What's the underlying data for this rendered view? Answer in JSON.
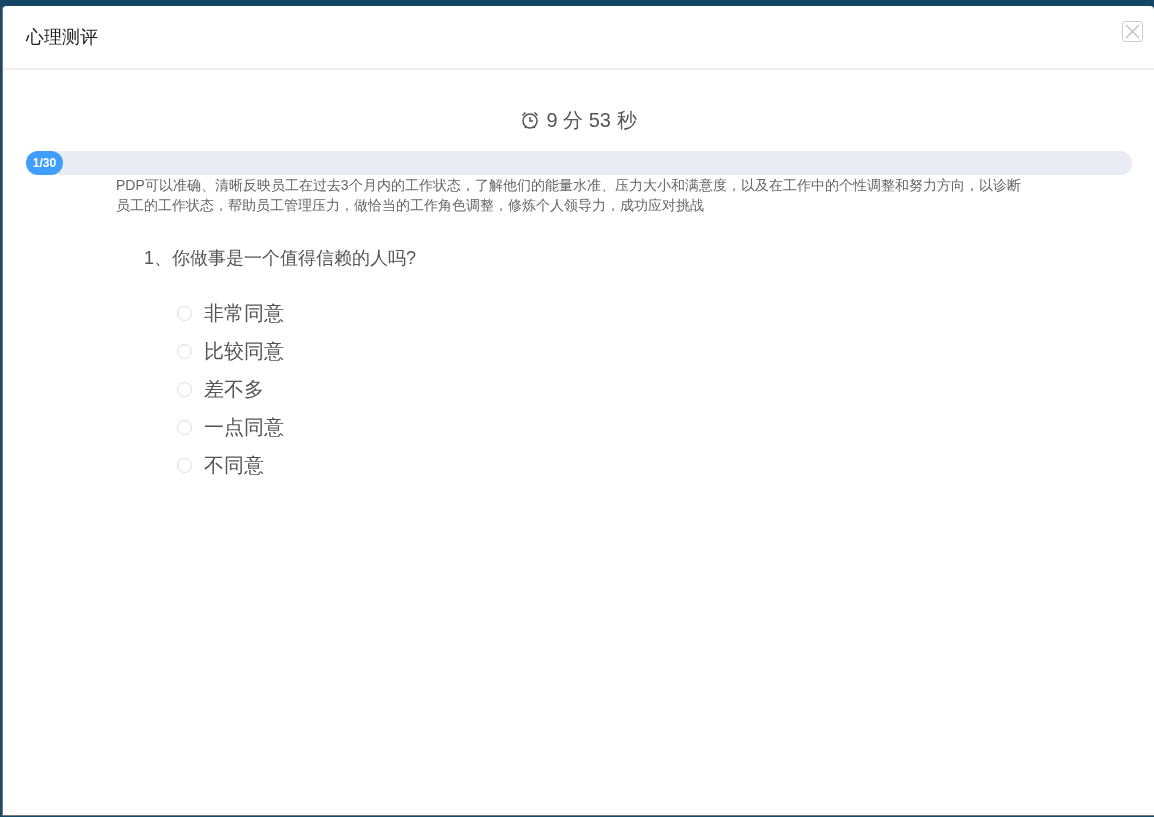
{
  "dialog": {
    "title": "心理测评"
  },
  "timer": {
    "minutes": "9",
    "minutes_unit": "分",
    "seconds": "53",
    "seconds_unit": "秒"
  },
  "progress": {
    "label": "1/30",
    "level": 0.033
  },
  "description": "PDP可以准确、清晰反映员工在过去3个月内的工作状态，了解他们的能量水准、压力大小和满意度，以及在工作中的个性调整和努力方向，以诊断员工的工作状态，帮助员工管理压力，做恰当的工作角色调整，修炼个人领导力，成功应对挑战",
  "question": {
    "text": "1、你做事是一个值得信赖的人吗?",
    "options": [
      {
        "label": "非常同意",
        "selected": false
      },
      {
        "label": "比较同意",
        "selected": false
      },
      {
        "label": "差不多",
        "selected": false
      },
      {
        "label": "一点同意",
        "selected": false
      },
      {
        "label": "不同意",
        "selected": false
      }
    ]
  }
}
